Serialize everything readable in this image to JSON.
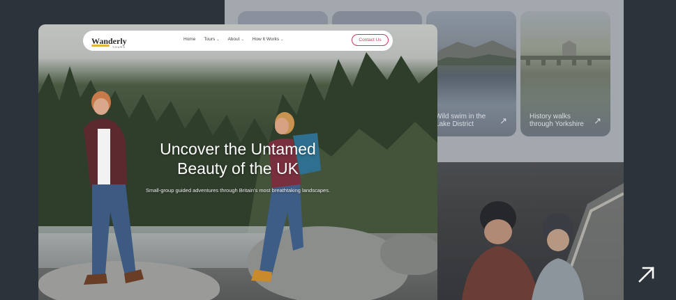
{
  "background_page": {
    "cards": [
      {
        "caption": ""
      },
      {
        "caption": ""
      },
      {
        "caption": "Wild swim in the Lake District"
      },
      {
        "caption": "History walks through Yorkshire"
      }
    ]
  },
  "site": {
    "logo": {
      "word": "Wanderly",
      "sub": "TOURS"
    },
    "nav": [
      {
        "label": "Home",
        "dropdown": false
      },
      {
        "label": "Tours",
        "dropdown": true
      },
      {
        "label": "About",
        "dropdown": true
      },
      {
        "label": "How It Works",
        "dropdown": true
      }
    ],
    "cta": "Contact Us"
  },
  "hero": {
    "title_line1": "Uncover the Untamed",
    "title_line2": "Beauty of the UK",
    "subtitle": "Small-group guided adventures through Britain's most breathtaking landscapes."
  },
  "icons": {
    "card_arrow": "arrow-up-right-icon",
    "corner": "arrow-up-right-icon"
  },
  "colors": {
    "accent": "#c23a5f",
    "logo_swoosh": "#e2b33a",
    "backdrop": "#2c333b"
  }
}
